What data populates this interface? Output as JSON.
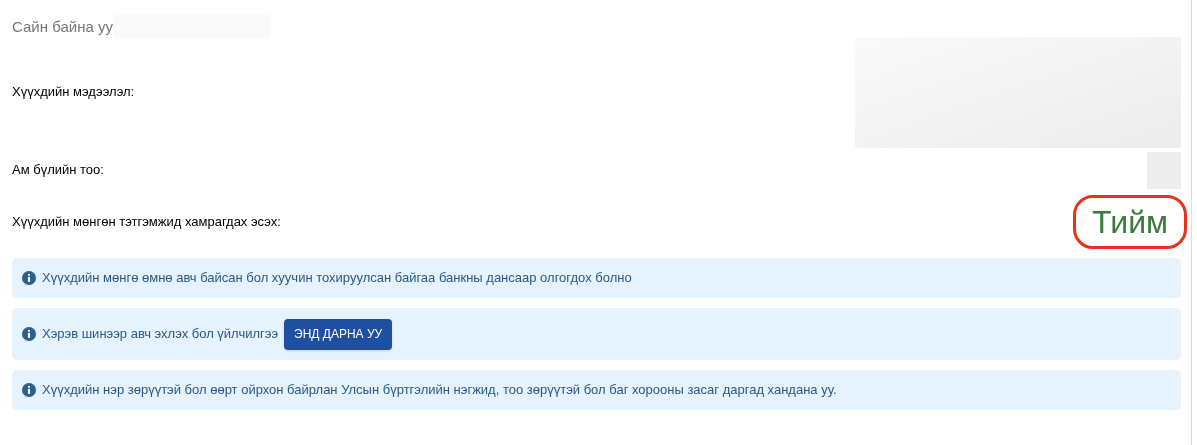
{
  "greeting": "Сайн байна уу",
  "fields": [
    {
      "label": "Хүүхдийн мэдээлэл:",
      "kind": "hidden-large"
    },
    {
      "label": "Ам бүлийн тоо:",
      "kind": "hidden-small"
    },
    {
      "label": "Хүүхдийн мөнгөн тэтгэмжид хамрагдах эсэх:",
      "kind": "text",
      "value": "Тийм",
      "circled": true
    }
  ],
  "alerts": [
    {
      "text": "Хүүхдийн мөнгө өмнө авч байсан бол хуучин тохируулсан байгаа банкны дансаар олгогдох болно"
    },
    {
      "text": "Хэрэв шинээр авч эхлэх бол үйлчилгээ",
      "button": "ЭНД ДАРНА УУ"
    },
    {
      "text": "Хүүхдийн нэр зөрүүтэй бол өөрт ойрхон байрлан Улсын бүртгэлийн нэгжид, тоо зөрүүтэй бол баг хорооны засаг даргад хандана уу."
    }
  ]
}
